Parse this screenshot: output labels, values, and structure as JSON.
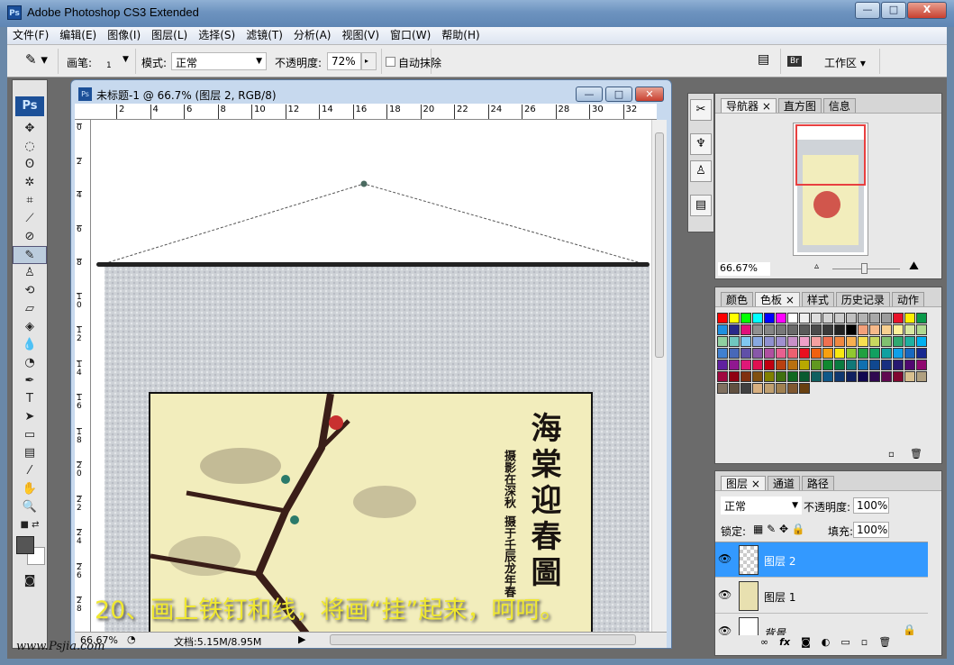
{
  "window": {
    "title": "Adobe Photoshop CS3 Extended",
    "app_icon": "Ps",
    "minimize": "—",
    "maximize": "□",
    "close": "X"
  },
  "menu": [
    "文件(F)",
    "编辑(E)",
    "图像(I)",
    "图层(L)",
    "选择(S)",
    "滤镜(T)",
    "分析(A)",
    "视图(V)",
    "窗口(W)",
    "帮助(H)"
  ],
  "options": {
    "brush_label": "画笔:",
    "brush_size": "1",
    "mode_label": "模式:",
    "mode_value": "正常",
    "opacity_label": "不透明度:",
    "opacity_value": "72%",
    "auto_erase_label": "自动抹除",
    "auto_erase_checked": false,
    "workspace_label": "工作区 ▾",
    "bridge_icon": "Br"
  },
  "toolbox": {
    "logo": "Ps"
  },
  "document": {
    "title": "未标题-1 @ 66.7% (图层 2, RGB/8)",
    "ruler_top": [
      "2",
      "4",
      "6",
      "8",
      "10",
      "12",
      "14",
      "16",
      "18",
      "20",
      "22",
      "24",
      "26",
      "28",
      "30",
      "32"
    ],
    "ruler_left": [
      "0",
      "2",
      "4",
      "6",
      "8",
      "10",
      "12",
      "14",
      "16",
      "18",
      "20",
      "22",
      "24",
      "26",
      "28"
    ],
    "zoom": "66.67%",
    "doc_size": "文档:5.15M/8.95M",
    "calligraphy_title": "海棠迎春圖",
    "calligraphy_sub1": "摄影在深秋",
    "calligraphy_sub2": "摄于壬辰龙年春"
  },
  "caption": "20、画上铁钉和线，将画“挂”起来，呵呵。",
  "watermark": "www.Psjia.com",
  "navigator": {
    "tabs": [
      "导航器",
      "直方图",
      "信息"
    ],
    "zoom": "66.67%",
    "zoom_level": 0.55
  },
  "swatches_panel": {
    "tabs": [
      "颜色",
      "色板",
      "样式",
      "历史记录",
      "动作"
    ],
    "colors": [
      "#ff0000",
      "#ffff00",
      "#00ff00",
      "#00ffff",
      "#0000ff",
      "#ff00ff",
      "#ffffff",
      "#eeeeee",
      "#dddddd",
      "#d4d4d4",
      "#cccccc",
      "#c0c0c0",
      "#b4b4b4",
      "#a8a8a8",
      "#9c9c9c",
      "#e8132a",
      "#ffee00",
      "#0a9a4a",
      "#1e90e0",
      "#2a2a8a",
      "#e0107a",
      "#909090",
      "#858585",
      "#787878",
      "#6a6a6a",
      "#5a5a5a",
      "#4a4a4a",
      "#3a3a3a",
      "#222222",
      "#000000",
      "#f4a07a",
      "#f6b98a",
      "#f8d090",
      "#fef09a",
      "#d8e8a0",
      "#b0d890",
      "#90d0a0",
      "#70c8c0",
      "#80c8f0",
      "#88a8e0",
      "#9090d0",
      "#a090d0",
      "#c890c8",
      "#f0a0c8",
      "#f4a0a0",
      "#f07050",
      "#f08840",
      "#f8b050",
      "#f8e050",
      "#c8d860",
      "#80c070",
      "#30a870",
      "#20b0a0",
      "#00b0f0",
      "#4080d0",
      "#4868b8",
      "#6050a8",
      "#8858a8",
      "#b050a0",
      "#e86090",
      "#ec6070",
      "#e81020",
      "#f06010",
      "#f8a010",
      "#f8e810",
      "#90c830",
      "#20a040",
      "#10a060",
      "#10a0a0",
      "#10a0e8",
      "#1868c0",
      "#182890",
      "#6020a0",
      "#901890",
      "#e01878",
      "#e01050",
      "#c00010",
      "#b84010",
      "#b87010",
      "#b8a800",
      "#609820",
      "#108830",
      "#0a7a40",
      "#107878",
      "#1070b0",
      "#104890",
      "#183080",
      "#281870",
      "#500870",
      "#900870",
      "#a00840",
      "#900010",
      "#803010",
      "#805010",
      "#808000",
      "#407010",
      "#106820",
      "#0a5a30",
      "#106060",
      "#105888",
      "#103870",
      "#102060",
      "#100850",
      "#300850",
      "#600850",
      "#800830",
      "#d8c090",
      "#b0a080",
      "#807060",
      "#605040",
      "#404040",
      "#d8b080",
      "#c0a070",
      "#a08050",
      "#805830",
      "#684010"
    ]
  },
  "layers_panel": {
    "tabs": [
      "图层",
      "通道",
      "路径"
    ],
    "blend_mode": "正常",
    "opacity_label": "不透明度:",
    "opacity": "100%",
    "lock_label": "锁定:",
    "fill_label": "填充:",
    "fill": "100%",
    "layers": [
      {
        "name": "图层 2",
        "selected": true
      },
      {
        "name": "图层 1",
        "selected": false
      },
      {
        "name": "背景",
        "selected": false
      }
    ],
    "footer_fx": "fx"
  }
}
